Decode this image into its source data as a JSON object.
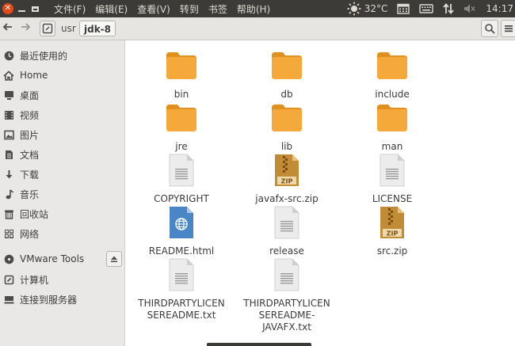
{
  "menubar": {
    "menus": [
      "文件(F)",
      "编辑(E)",
      "查看(V)",
      "转到",
      "书签",
      "帮助(H)"
    ],
    "weather": "32°C",
    "time": "14:17"
  },
  "toolbar": {
    "path": [
      "usr",
      "jdk-8"
    ]
  },
  "sidebar": {
    "items": [
      {
        "label": "最近使用的",
        "icon": "clock-icon"
      },
      {
        "label": "Home",
        "icon": "home-icon"
      },
      {
        "label": "桌面",
        "icon": "desktop-icon"
      },
      {
        "label": "视频",
        "icon": "video-icon"
      },
      {
        "label": "图片",
        "icon": "picture-icon"
      },
      {
        "label": "文档",
        "icon": "document-icon"
      },
      {
        "label": "下载",
        "icon": "download-icon"
      },
      {
        "label": "音乐",
        "icon": "music-icon"
      },
      {
        "label": "回收站",
        "icon": "trash-icon"
      },
      {
        "label": "网络",
        "icon": "network-icon"
      }
    ],
    "devices": [
      {
        "label": "VMware Tools",
        "icon": "disc-icon"
      },
      {
        "label": "计算机",
        "icon": "computer-icon"
      },
      {
        "label": "连接到服务器",
        "icon": "server-icon"
      }
    ]
  },
  "files": [
    {
      "name": "bin",
      "type": "folder"
    },
    {
      "name": "db",
      "type": "folder"
    },
    {
      "name": "include",
      "type": "folder"
    },
    {
      "name": "jre",
      "type": "folder"
    },
    {
      "name": "lib",
      "type": "folder"
    },
    {
      "name": "man",
      "type": "folder"
    },
    {
      "name": "COPYRIGHT",
      "type": "text"
    },
    {
      "name": "javafx-src.zip",
      "type": "zip"
    },
    {
      "name": "LICENSE",
      "type": "text"
    },
    {
      "name": "README.html",
      "type": "html"
    },
    {
      "name": "release",
      "type": "text"
    },
    {
      "name": "src.zip",
      "type": "zip"
    },
    {
      "name": "THIRDPARTYLICENSEREADME.txt",
      "type": "text",
      "lines": [
        "THIRDPARTYLICEN",
        "SEREADME.txt"
      ]
    },
    {
      "name": "THIRDPARTYLICENSEREADME-JAVAFX.txt",
      "type": "text",
      "lines": [
        "THIRDPARTYLICEN",
        "SEREADME-",
        "JAVAFX.txt"
      ]
    }
  ],
  "colors": {
    "folder": "#f5a93a",
    "zip": "#b07a2a",
    "html": "#4a86c5",
    "close": "#df4a16"
  }
}
